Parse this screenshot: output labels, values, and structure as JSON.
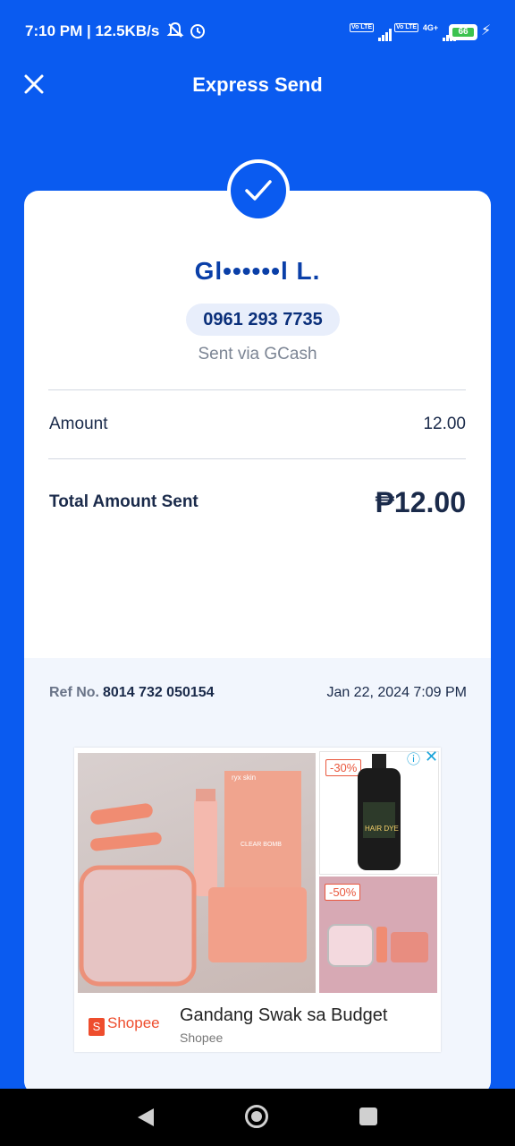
{
  "status_bar": {
    "time_speed": "7:10 PM | 12.5KB/s",
    "battery": "66",
    "network": "4G+",
    "lte": "Vo LTE"
  },
  "header": {
    "title": "Express Send"
  },
  "receipt": {
    "recipient_name": "Gl••••••l L.",
    "phone": "0961 293 7735",
    "sent_via": "Sent via GCash",
    "amount_label": "Amount",
    "amount_value": "12.00",
    "total_label": "Total Amount Sent",
    "total_value": "₱12.00",
    "ref_label": "Ref No.",
    "ref_number": "8014 732 050154",
    "date": "Jan 22, 2024 7:09 PM"
  },
  "ad": {
    "badge1": "-30%",
    "badge2": "-50%",
    "brand": "Shopee",
    "title": "Gandang Swak sa Budget",
    "subtitle": "Shopee",
    "product_label": "ryx skin",
    "product_sub": "CLEAR BOMB",
    "bottle_label": "HAIR DYE"
  },
  "colors": {
    "primary": "#0a5bf0",
    "text_dark": "#1a2a4a"
  }
}
